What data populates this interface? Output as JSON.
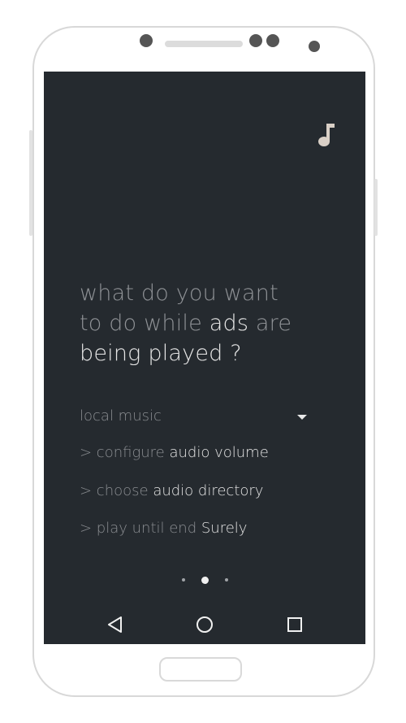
{
  "screen": {
    "background": "#252a2f",
    "icon": "music-note-icon",
    "headline": {
      "line1": "what do you want",
      "line2_a": "to do while ",
      "line2_b": "ads",
      "line2_c": " are",
      "line3": "being played ?"
    },
    "dropdown": {
      "selected": "local music",
      "icon": "dropdown-arrow-icon"
    },
    "options": [
      {
        "prefix": "> configure ",
        "value": "audio volume"
      },
      {
        "prefix": "> choose ",
        "value": "audio directory"
      },
      {
        "prefix": "> play until end ",
        "value": "Surely"
      }
    ],
    "pager": {
      "count": 3,
      "active": 2
    }
  },
  "navbar": {
    "back": "back-icon",
    "home": "home-icon",
    "recents": "recents-icon"
  }
}
